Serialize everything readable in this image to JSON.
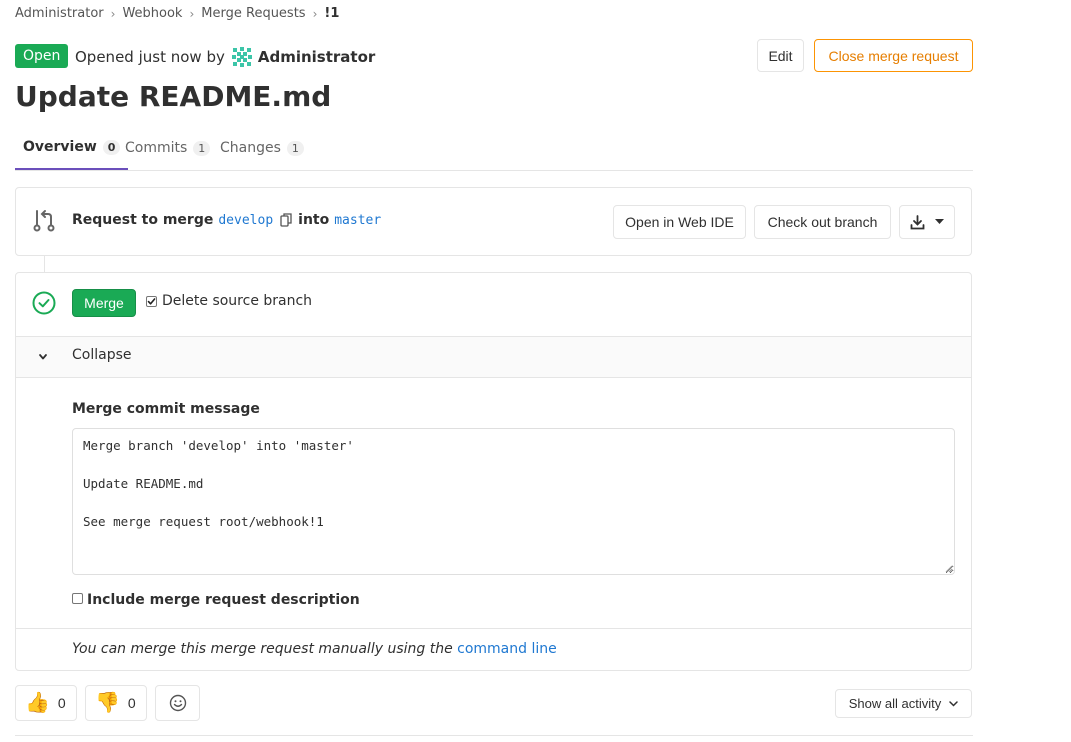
{
  "breadcrumb": {
    "items": [
      "Administrator",
      "Webhook",
      "Merge Requests",
      "!1"
    ]
  },
  "header": {
    "status_badge": "Open",
    "opened_text": "Opened just now by",
    "author": "Administrator",
    "edit_label": "Edit",
    "close_label": "Close merge request",
    "title": "Update README.md"
  },
  "tabs": [
    {
      "label": "Overview",
      "count": "0"
    },
    {
      "label": "Commits",
      "count": "1"
    },
    {
      "label": "Changes",
      "count": "1"
    }
  ],
  "request": {
    "prefix": "Request to merge",
    "source_branch": "develop",
    "into": "into",
    "target_branch": "master",
    "open_ide_label": "Open in Web IDE",
    "checkout_label": "Check out branch",
    "download_icon": "download-icon"
  },
  "merge": {
    "merge_label": "Merge",
    "delete_source_label": "Delete source branch",
    "delete_source_checked": true,
    "collapse_label": "Collapse",
    "commit_message_label": "Merge commit message",
    "commit_message": "Merge branch 'develop' into 'master'\n\nUpdate README.md\n\nSee merge request root/webhook!1",
    "include_description_label": "Include merge request description",
    "include_description_checked": false,
    "command_line_prefix": "You can merge this merge request manually using the",
    "command_line_link": "command line"
  },
  "awards": {
    "thumbsup_count": "0",
    "thumbsdown_count": "0"
  },
  "activity": {
    "label": "Show all activity"
  },
  "colors": {
    "success": "#1aaa55",
    "warning": "#fc9403",
    "link": "#1f78d1",
    "tab_active": "#6b4fbb"
  }
}
